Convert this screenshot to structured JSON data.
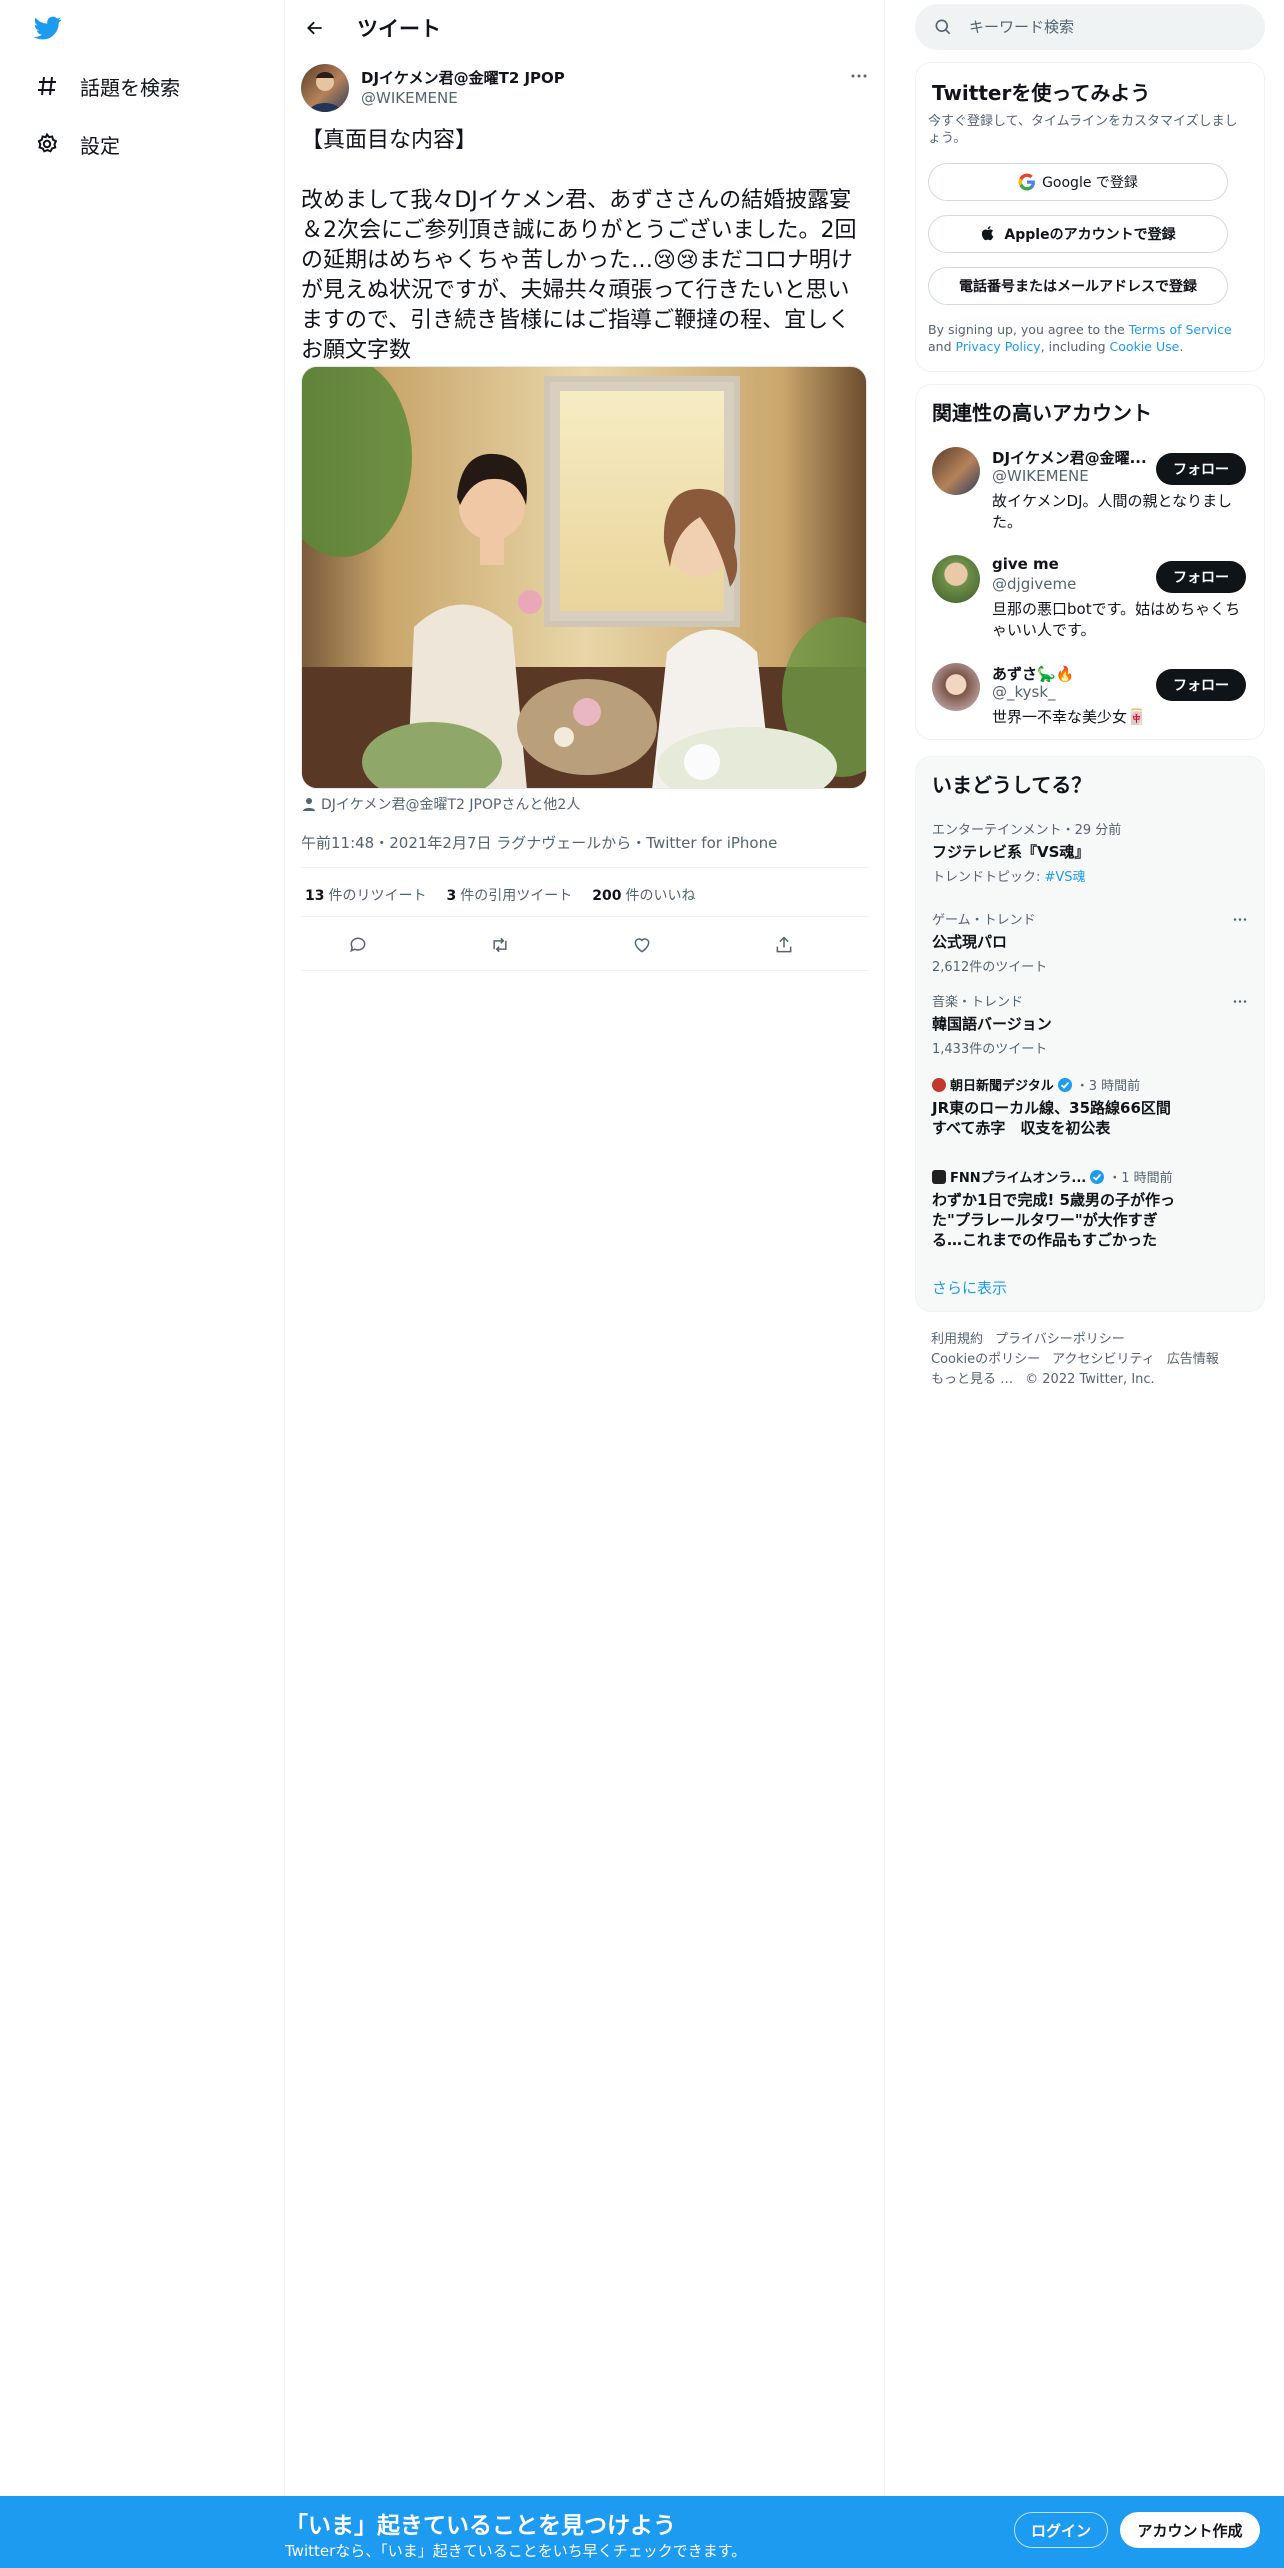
{
  "nav": {
    "items": [
      {
        "label": "話題を検索",
        "icon": "hashtag-icon"
      },
      {
        "label": "設定",
        "icon": "gear-icon"
      }
    ]
  },
  "header": {
    "title": "ツイート"
  },
  "tweet": {
    "author_name": "DJイケメン君@金曜T2 JPOP",
    "author_handle": "@WIKEMENE",
    "text": "【真面目な内容】\n\n改めまして我々DJイケメン君、あずささんの結婚披露宴＆2次会にご参列頂き誠にありがとうございました。2回の延期はめちゃくちゃ苦しかった…😢😢まだコロナ明けが見えぬ状況ですが、夫婦共々頑張って行きたいと思いますので、引き続き皆様にはご指導ご鞭撻の程、宜しくお願文字数",
    "tagged": "DJイケメン君@金曜T2 JPOPさんと他2人",
    "meta": "午前11:48・2021年2月7日 ラグナヴェールから・Twitter for iPhone",
    "stats": {
      "retweets_num": "13",
      "retweets_label": "件のリツイート",
      "quotes_num": "3",
      "quotes_label": "件の引用ツイート",
      "likes_num": "200",
      "likes_label": "件のいいね"
    }
  },
  "search": {
    "placeholder": "キーワード検索"
  },
  "signup_card": {
    "title": "Twitterを使ってみよう",
    "subtitle": "今すぐ登録して、タイムラインをカスタマイズしましょう。",
    "google": "Google で登録",
    "apple": "Appleのアカウントで登録",
    "phone": "電話番号またはメールアドレスで登録",
    "terms_pre": "By signing up, you agree to the ",
    "terms_tos": "Terms of Service",
    "terms_and": " and ",
    "terms_privacy": "Privacy Policy",
    "terms_including": ", including ",
    "terms_cookie": "Cookie Use",
    "terms_end": "."
  },
  "related": {
    "title": "関連性の高いアカウント",
    "follow_label": "フォロー",
    "accounts": [
      {
        "name": "DJイケメン君@金曜...",
        "handle": "@WIKEMENE",
        "bio": "故イケメンDJ。人間の親となりました。"
      },
      {
        "name": "give me",
        "handle": "@djgiveme",
        "bio": "旦那の悪口botです。姑はめちゃくちゃいい人です。"
      },
      {
        "name": "あずさ🦕🔥",
        "handle": "@_kysk_",
        "bio": "世界一不幸な美少女🀄"
      }
    ]
  },
  "trends": {
    "title": "いまどうしてる？",
    "items": [
      {
        "category": "エンターテインメント・29 分前",
        "name": "フジテレビ系『VS魂』",
        "extra_pre": "トレンドトピック: ",
        "extra_link": "#VS魂"
      },
      {
        "category": "ゲーム・トレンド",
        "name": "公式現パロ",
        "count": "2,612件のツイート"
      },
      {
        "category": "音楽・トレンド",
        "name": "韓国語バージョン",
        "count": "1,433件のツイート"
      }
    ],
    "news": [
      {
        "source": "朝日新聞デジタル",
        "time": "・3 時間前",
        "title": "JR東のローカル線、35路線66区間すべて赤字　収支を初公表"
      },
      {
        "source": "FNNプライムオンラ...",
        "time": "・1 時間前",
        "title": "わずか1日で完成! 5歳男の子が作った\"プラレールタワー\"が大作すぎる…これまでの作品もすごかった"
      }
    ],
    "show_more": "さらに表示"
  },
  "footer": {
    "links": [
      "利用規約",
      "プライバシーポリシー",
      "Cookieのポリシー",
      "アクセシビリティ",
      "広告情報",
      "もっと見る …"
    ],
    "copyright": "© 2022 Twitter, Inc."
  },
  "bottom_bar": {
    "title": "「いま」起きていることを見つけよう",
    "subtitle": "Twitterなら、「いま」起きていることをいち早くチェックできます。",
    "login": "ログイン",
    "signup": "アカウント作成"
  },
  "colors": {
    "accent": "#1d9bf0",
    "text": "#0f1419",
    "muted": "#536471"
  }
}
